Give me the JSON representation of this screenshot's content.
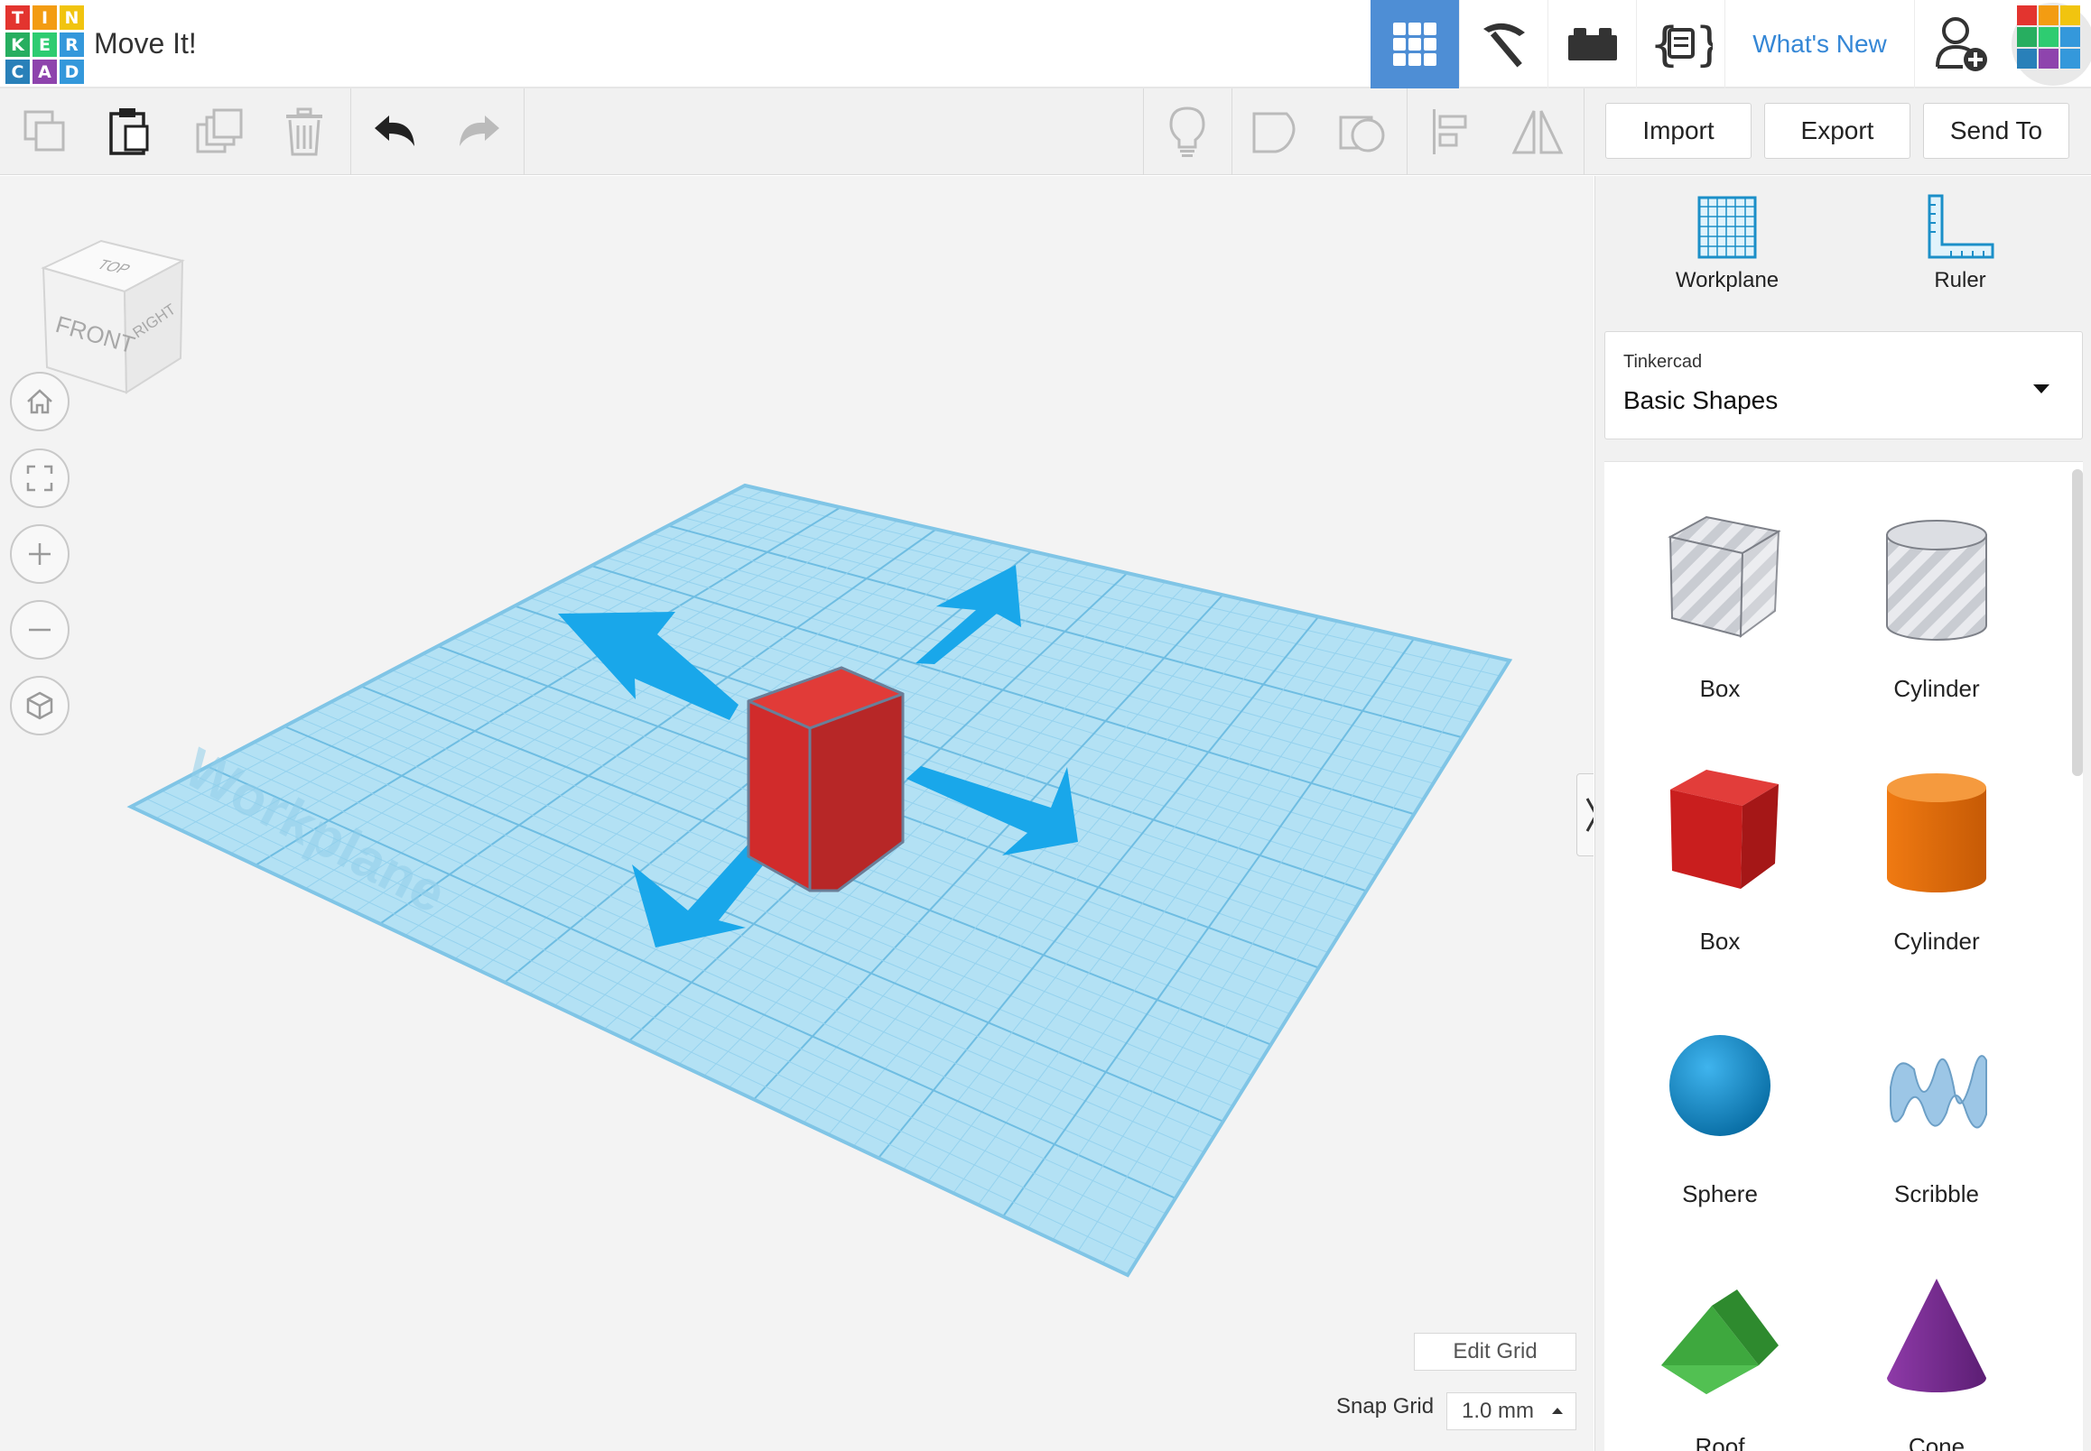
{
  "header": {
    "logo_letters": [
      "T",
      "I",
      "N",
      "K",
      "E",
      "R",
      "C",
      "A",
      "D"
    ],
    "logo_colors": [
      "#e3342f",
      "#f39c12",
      "#f1c40f",
      "#27ae60",
      "#2ecc71",
      "#3498db",
      "#2980b9",
      "#8e44ad",
      "#3498db"
    ],
    "title": "Move It!",
    "whats_new": "What's New",
    "nav_icons": [
      "3d-design-grid-icon",
      "pickaxe-icon",
      "bricks-icon",
      "codeblocks-icon",
      "add-user-icon"
    ]
  },
  "toolbar": {
    "left_icons": [
      "copy-icon",
      "paste-icon",
      "duplicate-icon",
      "delete-icon",
      "undo-icon",
      "redo-icon"
    ],
    "right_icons": [
      "notes-lightbulb-icon",
      "group-icon",
      "ungroup-icon",
      "align-icon",
      "mirror-icon"
    ],
    "import_label": "Import",
    "export_label": "Export",
    "send_to_label": "Send To"
  },
  "viewport": {
    "viewcube_faces": {
      "top": "TOP",
      "front": "FRONT",
      "right": "RIGHT"
    },
    "nav_buttons": [
      "home-view-icon",
      "fit-all-icon",
      "zoom-in-icon",
      "zoom-out-icon",
      "perspective-icon"
    ],
    "workplane_label": "Workplane",
    "edit_grid_label": "Edit Grid",
    "snap_grid_label": "Snap Grid",
    "snap_grid_value": "1.0 mm",
    "colors": {
      "workplane": "#aee0f4",
      "grid_line": "#7cc6e8",
      "arrow": "#1aa6e8",
      "cube": "#d42a2a"
    }
  },
  "panel": {
    "workplane_label": "Workplane",
    "ruler_label": "Ruler",
    "library_source": "Tinkercad",
    "library_name": "Basic Shapes",
    "shapes": [
      {
        "label": "Box",
        "kind": "box-hole"
      },
      {
        "label": "Cylinder",
        "kind": "cylinder-hole"
      },
      {
        "label": "Box",
        "kind": "box-red"
      },
      {
        "label": "Cylinder",
        "kind": "cylinder-orange"
      },
      {
        "label": "Sphere",
        "kind": "sphere-blue"
      },
      {
        "label": "Scribble",
        "kind": "scribble"
      },
      {
        "label": "Roof",
        "kind": "roof-green"
      },
      {
        "label": "Cone",
        "kind": "cone-purple"
      }
    ]
  }
}
